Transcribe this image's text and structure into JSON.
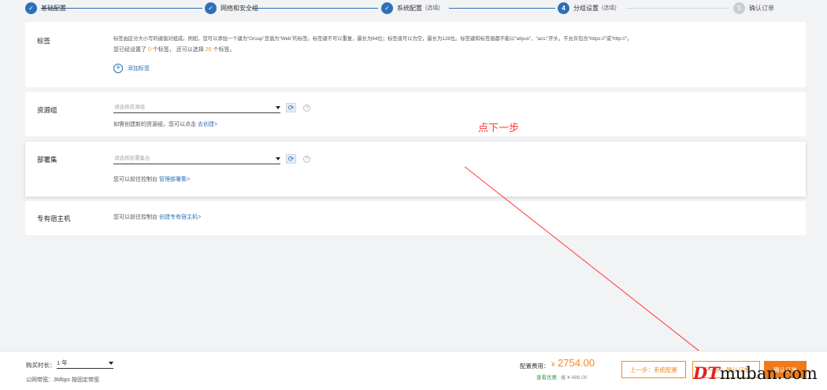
{
  "steps": [
    {
      "num": "",
      "label": "基础配置",
      "opt": "",
      "state": "done"
    },
    {
      "num": "",
      "label": "网络和安全组",
      "opt": "",
      "state": "done"
    },
    {
      "num": "",
      "label": "系统配置",
      "opt": "(选填)",
      "state": "done"
    },
    {
      "num": "4",
      "label": "分组设置",
      "opt": "(选填)",
      "state": "active"
    },
    {
      "num": "5",
      "label": "确认订单",
      "opt": "",
      "state": "todo"
    }
  ],
  "tags": {
    "title": "标签",
    "desc": "标签由区分大小写的键值对组成。例如，您可以添加一个键为“Group”且值为“Web”的标签。标签键不可以重复，最长为64位；标签值可以为空，最长为128位。标签键和标签值都不能以“aliyun”、“acs:”开头，不允许包含“https://”或“http://”。",
    "count_pre": "您已经设置了",
    "count_set": "0",
    "count_mid": "个标签， 还可以选择",
    "count_left": "20",
    "count_post": "个标签。",
    "add_label": "添加标签"
  },
  "resource_group": {
    "title": "资源组",
    "placeholder": "请选择资源组",
    "hint": "如需创建新的资源组，您可以点击",
    "hint_link": "去创建>"
  },
  "deployment_set": {
    "title": "部署集",
    "placeholder": "请选择部署集合",
    "hint": "您可以前往控制台",
    "hint_link": "管理部署集>"
  },
  "dedicated_host": {
    "title": "专有宿主机",
    "hint": "您可以前往控制台",
    "hint_link": "创建专有宿主机>"
  },
  "annotation": "点下一步",
  "footer": {
    "buy_label": "购买时长：",
    "buy_value": "1 年",
    "bandwidth": "公网带宽：3Mbps 按固定带宽",
    "cost_label": "配置费用：",
    "currency": "¥",
    "cost_value": "2754.00",
    "discount": "查看优惠",
    "save": "省 ¥ 486.00",
    "prev_button": "上一步：系统配置",
    "next_button": "下一步：确认订单",
    "confirm_button": "确认订单"
  },
  "watermark": {
    "dt": "DT",
    "rest": "muban.com"
  },
  "colors": {
    "primary": "#2f6fb7",
    "accent": "#f08a24",
    "annotation": "#ff3a3a"
  }
}
